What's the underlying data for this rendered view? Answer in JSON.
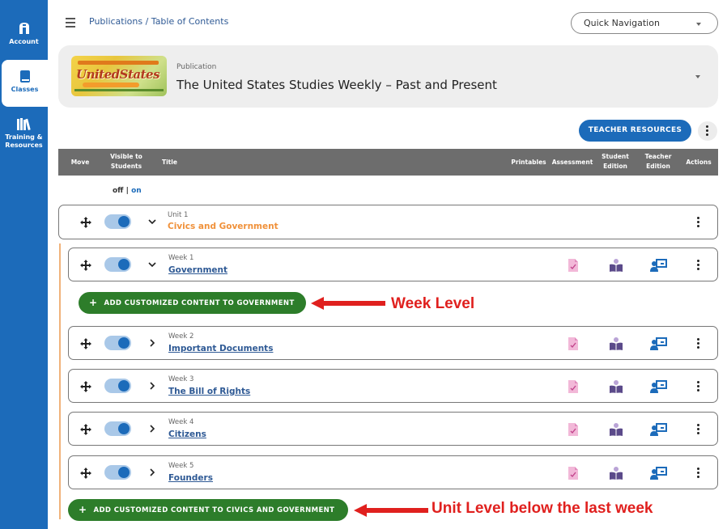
{
  "sidebar": {
    "items": [
      {
        "label": "Account",
        "icon": "account-icon"
      },
      {
        "label": "Classes",
        "icon": "book-icon"
      },
      {
        "label": "Training & Resources",
        "icon": "library-icon"
      }
    ]
  },
  "header": {
    "breadcrumb": "Publications / Table of Contents",
    "quick_nav": "Quick Navigation"
  },
  "publication": {
    "label": "Publication",
    "title": "The United States Studies Weekly – Past and Present",
    "thumb_text": "UnitedStates"
  },
  "toolbar": {
    "teacher_resources": "TEACHER RESOURCES"
  },
  "table": {
    "headers": {
      "move": "Move",
      "visible": "Visible to Students",
      "title": "Title",
      "printables": "Printables",
      "assessment": "Assessment",
      "student": "Student Edition",
      "teacher": "Teacher Edition",
      "actions": "Actions"
    },
    "off": "off",
    "sep": "|",
    "on": "on"
  },
  "unit": {
    "level": "Unit 1",
    "title": "Civics and Government"
  },
  "weeks": [
    {
      "level": "Week 1",
      "title": "Government"
    },
    {
      "level": "Week 2",
      "title": "Important Documents"
    },
    {
      "level": "Week 3",
      "title": "The Bill of Rights"
    },
    {
      "level": "Week 4",
      "title": "Citizens"
    },
    {
      "level": "Week 5",
      "title": "Founders"
    }
  ],
  "add_week": {
    "prefix": "ADD CUSTOMIZED CONTENT TO ",
    "target": "GOVERNMENT"
  },
  "add_unit": {
    "prefix": "ADD CUSTOMIZED CONTENT TO ",
    "target": "CIVICS AND GOVERNMENT"
  },
  "annotations": {
    "week_level": "Week Level",
    "unit_level": "Unit Level below the last week"
  },
  "colors": {
    "sidebar": "#1c6bba",
    "unit_title": "#f0913a",
    "add_button": "#2d7d2a",
    "annotation": "#e0201e"
  }
}
